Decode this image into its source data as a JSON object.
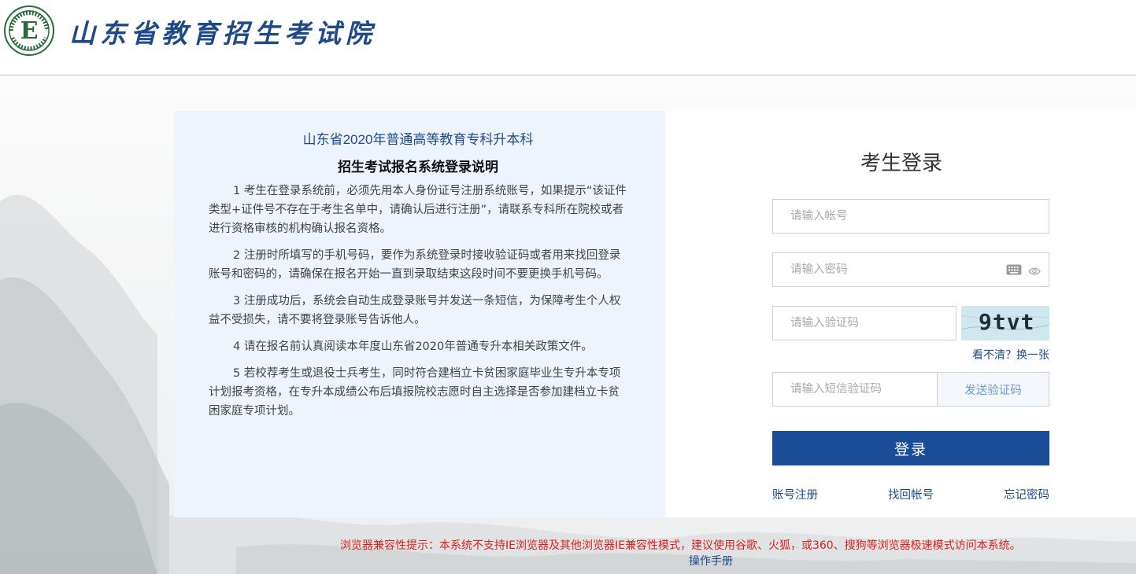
{
  "header": {
    "site_title": "山东省教育招生考试院",
    "logo_letter": "E"
  },
  "notice": {
    "title_line1": "山东省2020年普通高等教育专科升本科",
    "title_line2": "招生考试报名系统登录说明",
    "items": [
      "1 考生在登录系统前，必须先用本人身份证号注册系统账号，如果提示“该证件类型+证件号不存在于考生名单中，请确认后进行注册”，请联系专科所在院校或者进行资格审核的机构确认报名资格。",
      "2 注册时所填写的手机号码，要作为系统登录时接收验证码或者用来找回登录账号和密码的，请确保在报名开始一直到录取结束这段时间不要更换手机号码。",
      "3 注册成功后，系统会自动生成登录账号并发送一条短信，为保障考生个人权益不受损失，请不要将登录账号告诉他人。",
      "4 请在报名前认真阅读本年度山东省2020年普通专升本相关政策文件。",
      "5 若校荐考生或退役士兵考生，同时符合建档立卡贫困家庭毕业生专升本专项计划报考资格，在专升本成绩公布后填报院校志愿时自主选择是否参加建档立卡贫困家庭专项计划。"
    ]
  },
  "login": {
    "title": "考生登录",
    "account_placeholder": "请输入帐号",
    "password_placeholder": "请输入密码",
    "captcha_placeholder": "请输入验证码",
    "captcha_text": "9tvt",
    "refresh_label": "看不清？换一张",
    "sms_placeholder": "请输入短信验证码",
    "send_code_label": "发送验证码",
    "submit_label": "登录",
    "register_label": "账号注册",
    "recover_account_label": "找回帐号",
    "forgot_password_label": "忘记密码"
  },
  "footer": {
    "compat_notice": "浏览器兼容性提示：本系统不支持IE浏览器及其他浏览器IE兼容性模式，建议使用谷歌、火狐，或360、搜狗等浏览器极速模式访问本系统。",
    "manual_label": "操作手册"
  },
  "colors": {
    "brand_blue": "#1b4c97",
    "notice_bg": "#edf4fd",
    "warning_red": "#d9231f"
  }
}
